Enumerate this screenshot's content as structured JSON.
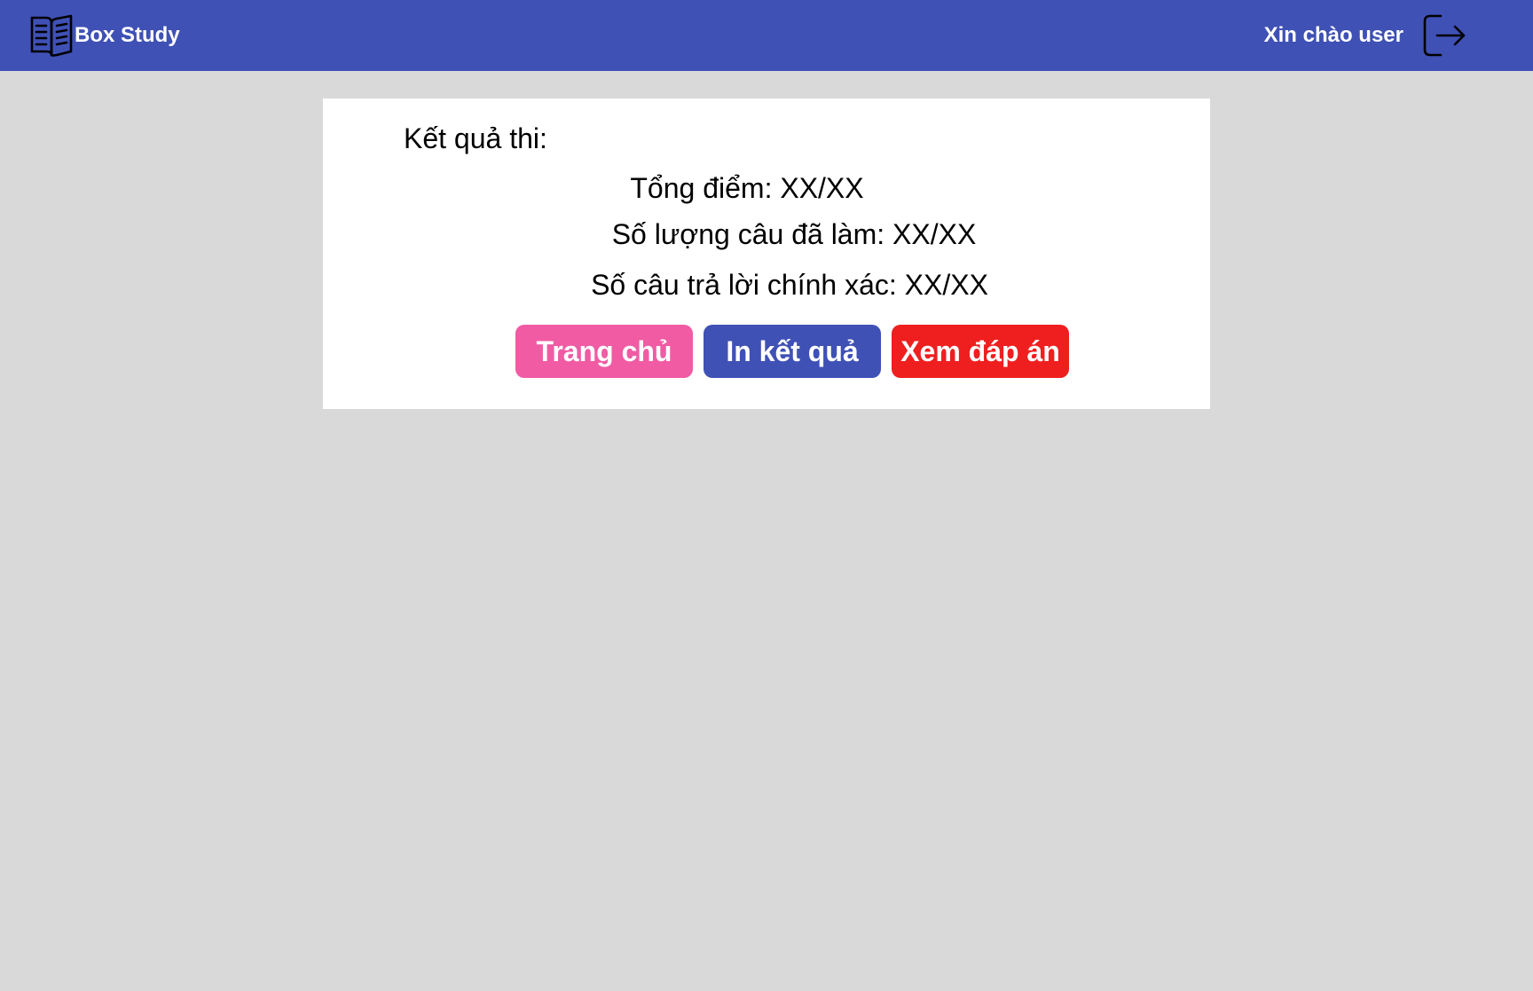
{
  "header": {
    "brand_name": "Box Study",
    "brand_icon": "open-book-icon",
    "greeting": "Xin chào user",
    "logout_icon": "logout-icon",
    "background_color": "#3f51b5"
  },
  "result": {
    "title": "Kết quả thi:",
    "total_score": "Tổng điểm: XX/XX",
    "answered_count": "Số lượng câu đã làm: XX/XX",
    "correct_count": "Số câu trả lời chính xác: XX/XX"
  },
  "actions": {
    "home_label": "Trang chủ",
    "print_label": "In kết quả",
    "view_answers_label": "Xem đáp án",
    "home_color": "#f05ba4",
    "print_color": "#3f51b5",
    "view_answers_color": "#ef1f1f"
  },
  "page": {
    "background_color": "#d9d9d9"
  }
}
